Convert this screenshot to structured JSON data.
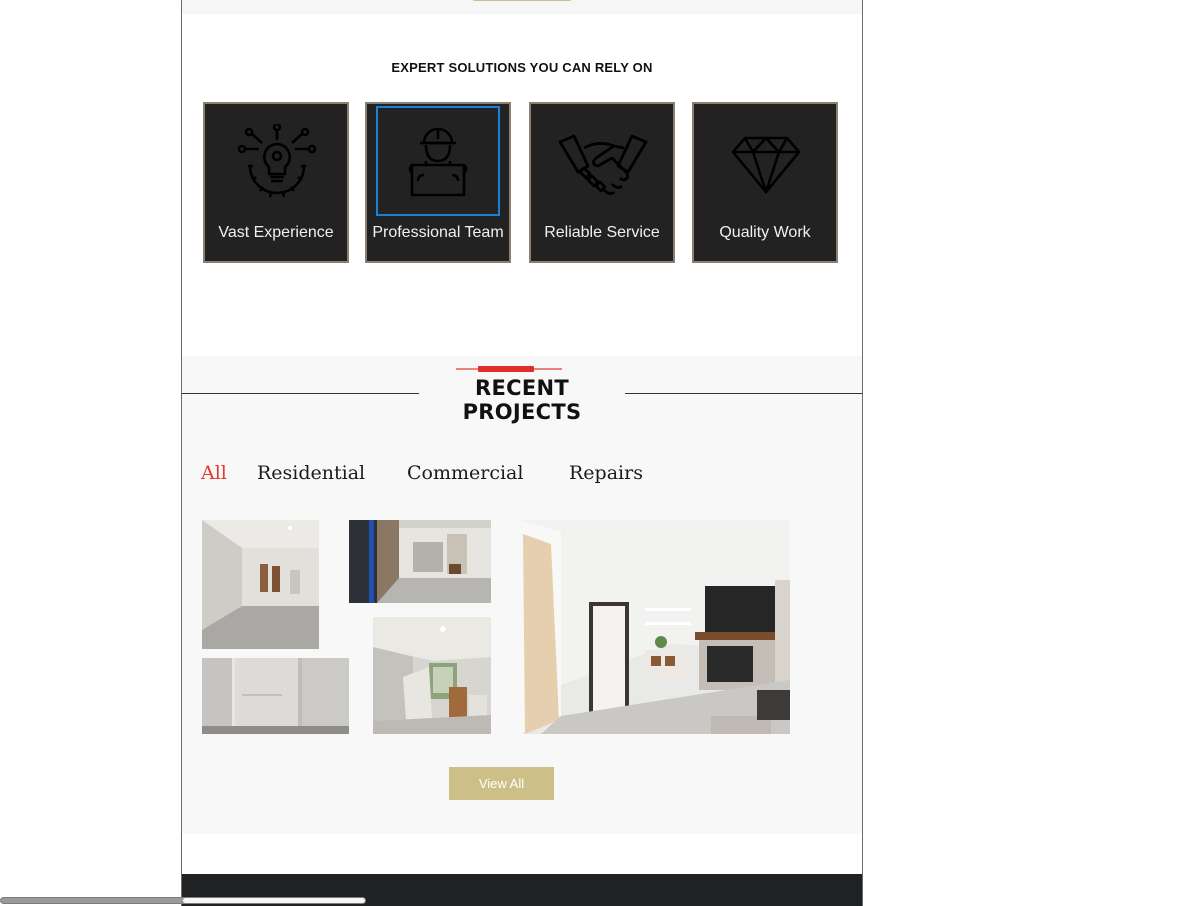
{
  "features": {
    "title": "EXPERT SOLUTIONS YOU CAN RELY ON",
    "items": [
      {
        "label": "Vast Experience",
        "icon": "lightbulb-gear-icon"
      },
      {
        "label": "Professional Team",
        "icon": "worker-blueprint-icon"
      },
      {
        "label": "Reliable Service",
        "icon": "handshake-icon"
      },
      {
        "label": "Quality Work",
        "icon": "diamond-icon"
      }
    ]
  },
  "projects": {
    "heading": "RECENT PROJECTS",
    "filters": [
      "All",
      "Residential",
      "Commercial",
      "Repairs"
    ],
    "active_filter": "All",
    "view_all_label": "View All"
  },
  "colors": {
    "accent_red": "#e23a32",
    "gold_button": "#cdbf88",
    "card_bg": "#222222",
    "footer_bg": "#1f2123"
  }
}
